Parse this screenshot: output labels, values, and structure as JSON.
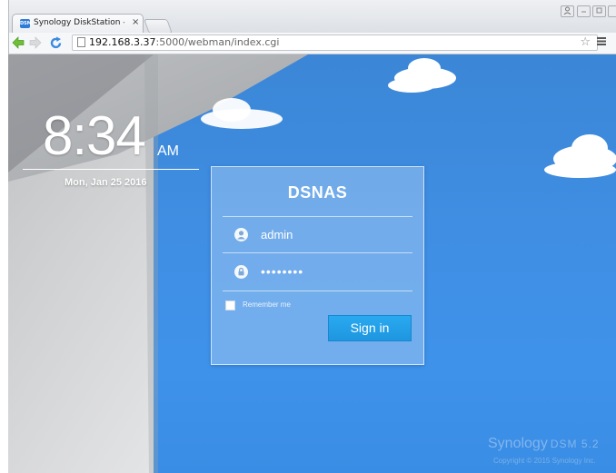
{
  "browser": {
    "tab_title": "Synology DiskStation - D",
    "tab_close": "×",
    "favicon_text": "DSM",
    "url_host": "192.168.3.37",
    "url_rest": ":5000/webman/index.cgi",
    "icons": [
      "back-arrow-icon",
      "forward-arrow-icon",
      "reload-icon",
      "page-icon",
      "star-icon",
      "menu-icon"
    ]
  },
  "clock": {
    "time": "8:34",
    "ampm": "AM",
    "date": "Mon, Jan 25 2016"
  },
  "login": {
    "server_name": "DSNAS",
    "username": "admin",
    "password_mask": "••••••••",
    "remember_label": "Remember me",
    "signin_label": "Sign in"
  },
  "footer": {
    "brand": "Synology",
    "product": "DSM 5.2",
    "copyright": "Copyright © 2015 Synology Inc."
  },
  "colors": {
    "sky": "#3f8ee3",
    "signin_button": "#1e96e0",
    "panel": "#c4def8"
  }
}
